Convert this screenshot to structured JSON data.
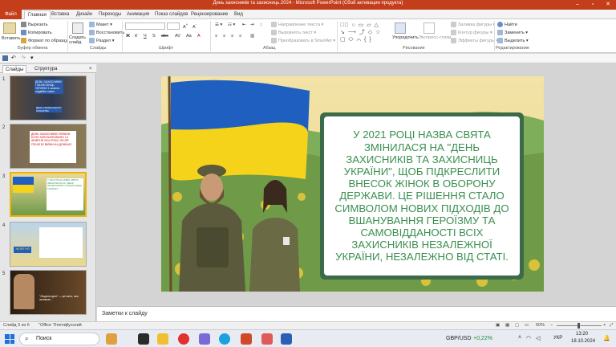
{
  "window": {
    "title": "День захисників та захисниць.2024 - Microsoft PowerPoint (Сбой активации продукта)"
  },
  "tabs": {
    "file": "Файл",
    "items": [
      "Главная",
      "Вставка",
      "Дизайн",
      "Переходы",
      "Анимация",
      "Показ слайдов",
      "Рецензирование",
      "Вид"
    ]
  },
  "ribbon": {
    "clipboard": {
      "paste": "Вставить",
      "cut": "Вырезать",
      "copy": "Копировать",
      "format": "Формат по образцу",
      "group": "Буфер обмена"
    },
    "slides": {
      "new_slide": "Создать слайд",
      "layout": "Макет",
      "reset": "Восстановить",
      "section": "Раздел",
      "group": "Слайды"
    },
    "font": {
      "group": "Шрифт"
    },
    "paragraph": {
      "text_direction": "Направление текста",
      "align_text": "Выровнять текст",
      "smartart": "Преобразовать в SmartArt",
      "group": "Абзац"
    },
    "drawing": {
      "arrange": "Упорядочить",
      "quick_styles": "Экспресс-стили",
      "fill": "Заливка фигуры",
      "outline": "Контур фигуры",
      "effects": "Эффекты фигуры",
      "group": "Рисование"
    },
    "editing": {
      "find": "Найти",
      "replace": "Заменить",
      "select": "Выделить",
      "group": "Редактирование"
    }
  },
  "panel": {
    "tabs": [
      "Слайды",
      "Структура"
    ],
    "close": "×",
    "thumbnails": [
      {
        "num": "1",
        "text": "ДЕНЬ ЗАХИСНИКІВ І ЗАХИСНИЦЬ УКРАЇНИ 1 жовтня подвійне свято",
        "sub": "ДЕНЬ УКРАЇНСЬКОГО КОЗАЦТВА"
      },
      {
        "num": "2",
        "text": "ДЕНЬ ЗАХИСНИКІВ УКРАЇНИ БУЛО ЗАПОЧАТКОВАНО 14 ЖОВТНЯ 2014 РОКУ, ПІСЛЯ ПОЧАТКУ ВІЙНИ НА ДОНБАСІ."
      },
      {
        "num": "3",
        "text": "У 2021 РОЦІ НАЗВА СВЯТА ЗМІНИЛАСЯ НА \"ДЕНЬ ЗАХИСНИКІВ ТА ЗАХИСНИЦЬ УКРАЇНИ\""
      },
      {
        "num": "4",
        "text": "ЖОВТНЯ"
      },
      {
        "num": "5",
        "text": "\"Людина-ідея\" — це мить, яка залишає..."
      }
    ]
  },
  "slide": {
    "body": "У 2021 РОЦІ НАЗВА СВЯТА ЗМІНИЛАСЯ НА \"ДЕНЬ ЗАХИСНИКІВ ТА ЗАХИСНИЦЬ УКРАЇНИ\", ЩОБ ПІДКРЕСЛИТИ ВНЕСОК ЖІНОК В ОБОРОНУ ДЕРЖАВИ. ЦЕ РІШЕННЯ СТАЛО СИМВОЛОМ НОВИХ ПІДХОДІВ ДО ВШАНУВАННЯ ГЕРОЇЗМУ ТА САМОВІДДАНОСТІ ВСІХ ЗАХИСНИКІВ НЕЗАЛЕЖНОЇ УКРАЇНИ, НЕЗАЛЕЖНО ВІД СТАТІ.",
    "text_color": "#3a8f4f",
    "flag_blue": "#1f5fbf",
    "flag_yellow": "#f5d31a"
  },
  "notes": {
    "placeholder": "Заметки к слайду"
  },
  "statusbar": {
    "slide_info": "Слайд 3 из 6",
    "theme": "\"Office Theme\"",
    "language": "русский",
    "zoom": "50%"
  },
  "taskbar": {
    "search": "Поиск",
    "ticker": "GBP/USD",
    "change": "+0,22%",
    "lang": "УКР",
    "time": "13:20",
    "date": "18.10.2024"
  },
  "colors": {
    "accent": "#c43e1c",
    "selected_thumb": "#f0b400"
  }
}
